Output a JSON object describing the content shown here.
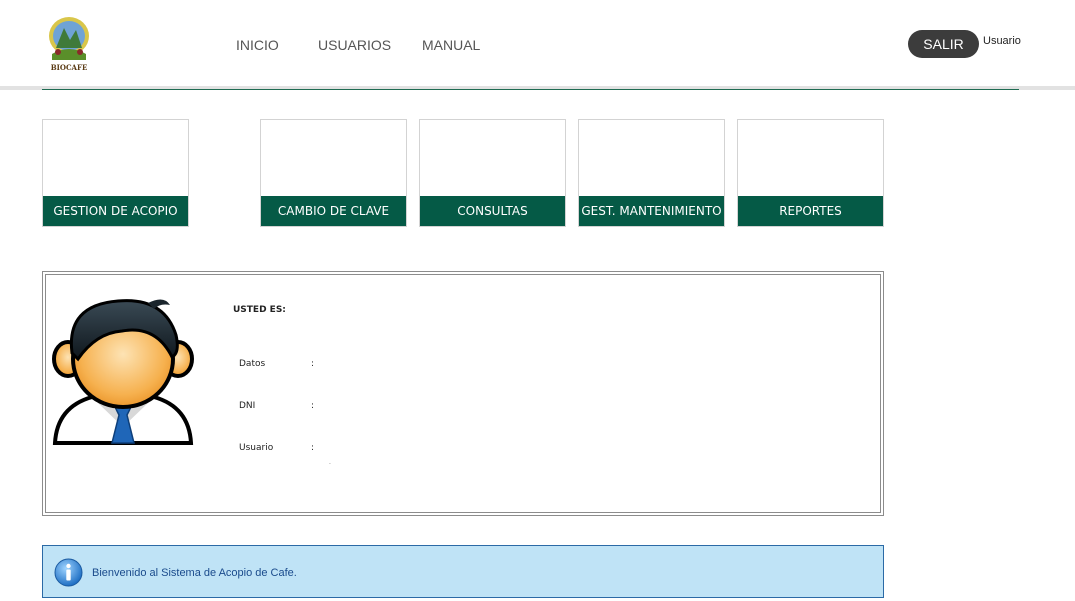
{
  "header": {
    "logo_text": "BIOCAFE",
    "nav": [
      {
        "label": "INICIO"
      },
      {
        "label": "USUARIOS"
      },
      {
        "label": "MANUAL"
      }
    ],
    "logout_label": "SALIR",
    "user_label": "Usuario"
  },
  "tiles": [
    {
      "label": "GESTION DE ACOPIO"
    },
    {
      "label": "CAMBIO DE CLAVE"
    },
    {
      "label": "CONSULTAS"
    },
    {
      "label": "GEST. MANTENIMIENTO"
    },
    {
      "label": "REPORTES"
    }
  ],
  "profile": {
    "heading": "USTED ES:",
    "fields": [
      {
        "label": "Datos",
        "sep": ":"
      },
      {
        "label": "DNI",
        "sep": ":"
      },
      {
        "label": "Usuario",
        "sep": ":"
      }
    ],
    "trailing_mark": "."
  },
  "message": {
    "icon": "info-icon",
    "text": "Bienvenido al Sistema de Acopio de Cafe."
  },
  "colors": {
    "tile_green": "#055a46",
    "logout_bg": "#3c3c3c",
    "info_bg": "#bfe3f6",
    "info_border": "#2b6aa6"
  }
}
